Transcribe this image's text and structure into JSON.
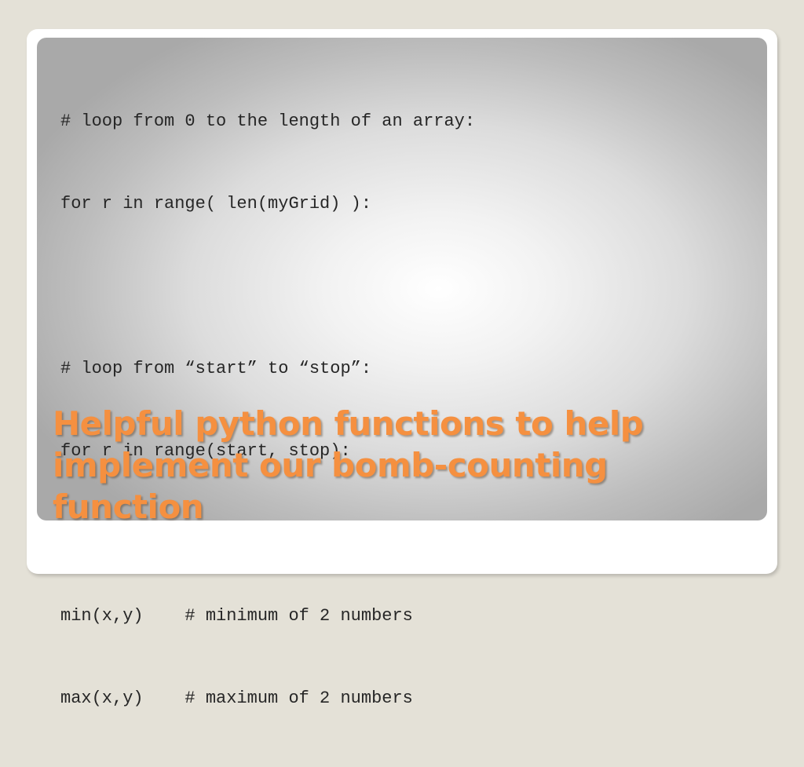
{
  "slide": {
    "code_lines": [
      "# loop from 0 to the length of an array:",
      "for r in range( len(myGrid) ):",
      "",
      "# loop from “start” to “stop”:",
      "for r in range(start, stop):",
      "",
      "min(x,y)    # minimum of 2 numbers",
      "max(x,y)    # maximum of 2 numbers"
    ],
    "title": "Helpful python functions to help implement our bomb-counting function",
    "colors": {
      "title": "#f59040",
      "code_text": "#262626",
      "background": "#e4e1d7",
      "frame": "#ffffff"
    }
  }
}
